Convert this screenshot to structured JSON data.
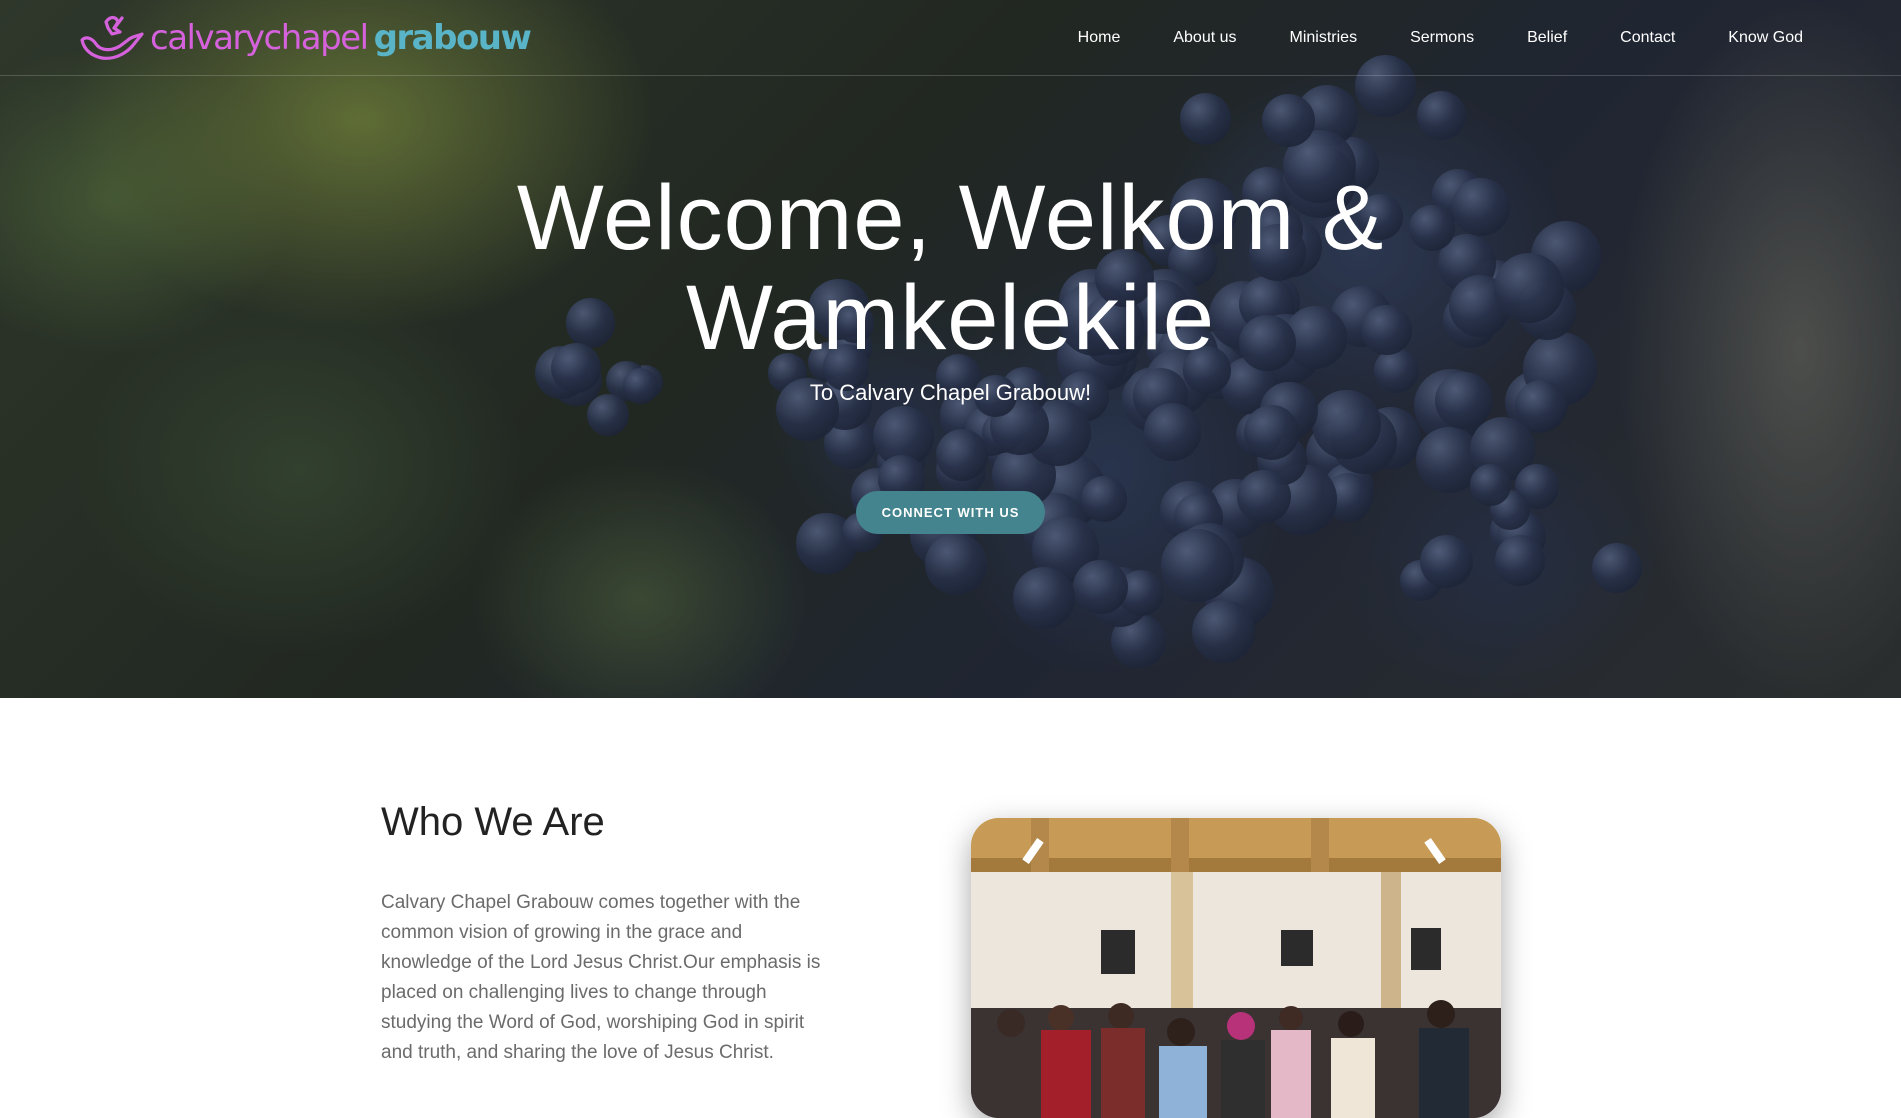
{
  "header": {
    "logo": {
      "light_text": "calvarychapel",
      "bold_text": "grabouw"
    },
    "nav": [
      {
        "label": "Home"
      },
      {
        "label": "About us"
      },
      {
        "label": "Ministries"
      },
      {
        "label": "Sermons"
      },
      {
        "label": "Belief"
      },
      {
        "label": "Contact"
      },
      {
        "label": "Know God"
      }
    ]
  },
  "hero": {
    "title_line1": "Welcome, Welkom &",
    "title_line2": "Wamkelekile",
    "subtitle": "To Calvary Chapel Grabouw!",
    "cta_label": "CONNECT WITH US"
  },
  "about": {
    "title": "Who We Are",
    "body": "Calvary Chapel Grabouw comes together with the common vision of growing in the grace and knowledge of the Lord Jesus Christ.Our emphasis is placed on challenging lives to change through studying the Word of God, worshiping God in spirit and truth, and sharing the love of Jesus Christ."
  },
  "colors": {
    "logo_light": "#d562dc",
    "logo_bold": "#59b4c8",
    "accent_button": "#44848e"
  },
  "icons": {
    "logo_mark": "dove-icon"
  }
}
